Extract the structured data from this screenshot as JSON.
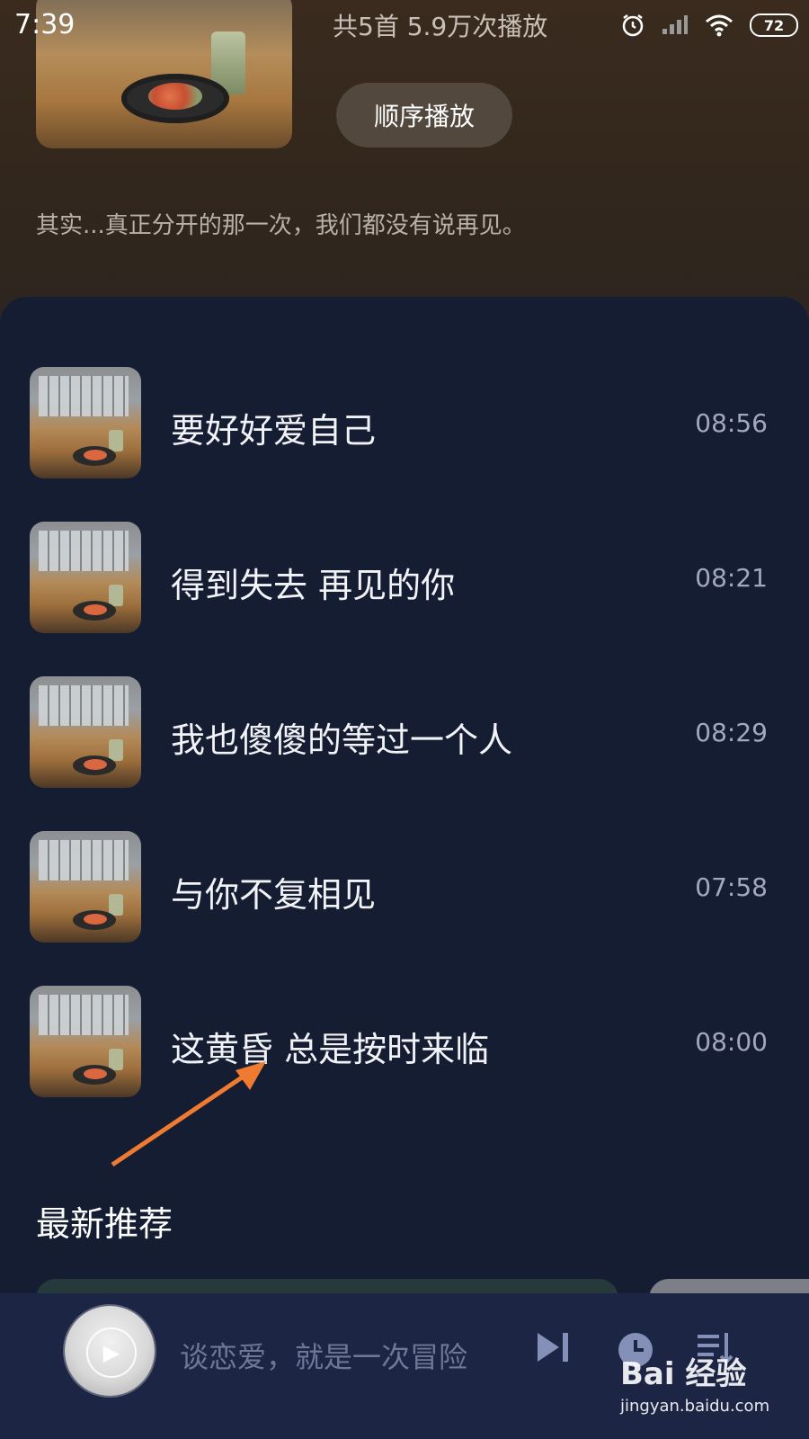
{
  "status_bar": {
    "time": "7:39",
    "battery": "72",
    "icons": [
      "alarm-icon",
      "signal-icon",
      "wifi-icon",
      "battery-icon"
    ]
  },
  "header": {
    "stats": "共5首   5.9万次播放",
    "play_order_label": "顺序播放",
    "description": "其实...真正分开的那一次，我们都没有说再见。"
  },
  "songs": [
    {
      "title": "要好好爱自己",
      "duration": "08:56"
    },
    {
      "title": "得到失去 再见的你",
      "duration": "08:21"
    },
    {
      "title": "我也傻傻的等过一个人",
      "duration": "08:29"
    },
    {
      "title": "与你不复相见",
      "duration": "07:58"
    },
    {
      "title": "这黄昏 总是按时来临",
      "duration": "08:00"
    }
  ],
  "annotation": {
    "label": "最新推荐",
    "arrow_color": "#f07a2f"
  },
  "player": {
    "now_playing": "谈恋爱，就是一次冒险",
    "controls": [
      "next-icon",
      "timer-icon",
      "playlist-icon"
    ]
  },
  "watermark": {
    "logo": "Bai 经验",
    "url": "jingyan.baidu.com"
  },
  "colors": {
    "list_bg": "#151d33",
    "player_bg": "#1c2544",
    "header_bg": "#3a2b1e"
  }
}
